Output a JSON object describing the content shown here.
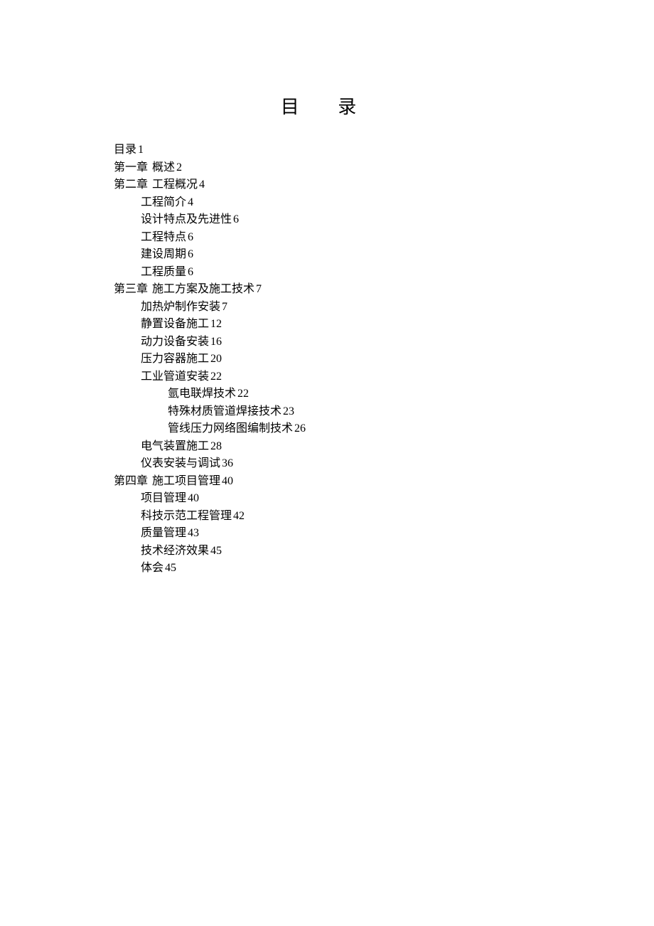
{
  "title": "目  录",
  "entries": [
    {
      "level": 0,
      "chapter": "",
      "text": "目录",
      "page": "1"
    },
    {
      "level": 0,
      "chapter": "第一章",
      "text": "概述",
      "page": "2"
    },
    {
      "level": 0,
      "chapter": "第二章",
      "text": "工程概况",
      "page": "4"
    },
    {
      "level": 1,
      "chapter": "",
      "text": "工程简介",
      "page": "4"
    },
    {
      "level": 1,
      "chapter": "",
      "text": "设计特点及先进性",
      "page": "6"
    },
    {
      "level": 1,
      "chapter": "",
      "text": "工程特点",
      "page": "6"
    },
    {
      "level": 1,
      "chapter": "",
      "text": "建设周期",
      "page": "6"
    },
    {
      "level": 1,
      "chapter": "",
      "text": "工程质量",
      "page": "6"
    },
    {
      "level": 0,
      "chapter": "第三章",
      "text": "施工方案及施工技术",
      "page": "7"
    },
    {
      "level": 1,
      "chapter": "",
      "text": "加热炉制作安装",
      "page": "7"
    },
    {
      "level": 1,
      "chapter": "",
      "text": "静置设备施工",
      "page": "12"
    },
    {
      "level": 1,
      "chapter": "",
      "text": "动力设备安装",
      "page": "16"
    },
    {
      "level": 1,
      "chapter": "",
      "text": "压力容器施工",
      "page": "20"
    },
    {
      "level": 1,
      "chapter": "",
      "text": "工业管道安装",
      "page": "22"
    },
    {
      "level": 2,
      "chapter": "",
      "text": "氩电联焊技术",
      "page": "22"
    },
    {
      "level": 2,
      "chapter": "",
      "text": "特殊材质管道焊接技术",
      "page": "23"
    },
    {
      "level": 2,
      "chapter": "",
      "text": "管线压力网络图编制技术",
      "page": "26"
    },
    {
      "level": 1,
      "chapter": "",
      "text": "电气装置施工",
      "page": "28"
    },
    {
      "level": 1,
      "chapter": "",
      "text": "仪表安装与调试",
      "page": "36"
    },
    {
      "level": 0,
      "chapter": "第四章",
      "text": "施工项目管理",
      "page": "40"
    },
    {
      "level": 1,
      "chapter": "",
      "text": "项目管理",
      "page": "40"
    },
    {
      "level": 1,
      "chapter": "",
      "text": "科技示范工程管理",
      "page": "42"
    },
    {
      "level": 1,
      "chapter": "",
      "text": "质量管理",
      "page": "43"
    },
    {
      "level": 1,
      "chapter": "",
      "text": "技术经济效果",
      "page": "45"
    },
    {
      "level": 1,
      "chapter": "",
      "text": "体会",
      "page": "45"
    }
  ]
}
